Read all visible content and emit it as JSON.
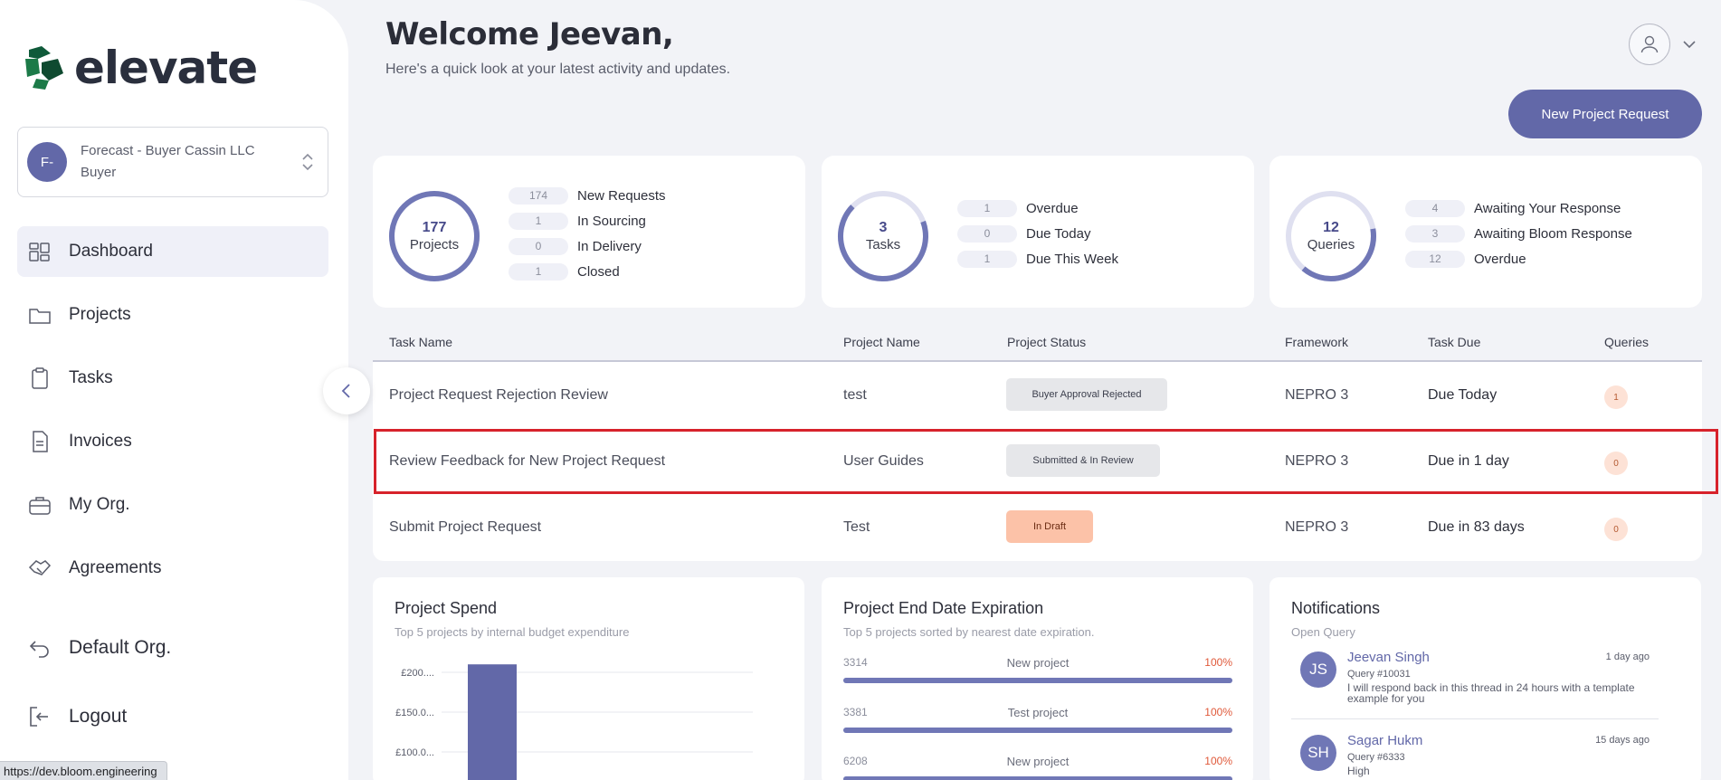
{
  "brand": {
    "name": "elevate"
  },
  "org": {
    "initials": "F-",
    "name": "Forecast - Buyer Cassin LLC",
    "role": "Buyer"
  },
  "nav": {
    "items": [
      {
        "label": "Dashboard",
        "icon": "dashboard-icon",
        "active": true
      },
      {
        "label": "Projects",
        "icon": "folder-icon"
      },
      {
        "label": "Tasks",
        "icon": "clipboard-icon"
      },
      {
        "label": "Invoices",
        "icon": "document-icon"
      },
      {
        "label": "My Org.",
        "icon": "briefcase-icon"
      },
      {
        "label": "Agreements",
        "icon": "handshake-icon"
      }
    ],
    "default_org": "Default Org.",
    "logout": "Logout"
  },
  "status_url": "https://dev.bloom.engineering",
  "header": {
    "welcome": "Welcome Jeevan,",
    "subtitle": "Here's a quick look at your latest activity and updates.",
    "new_project_label": "New Project Request"
  },
  "stats": {
    "projects": {
      "value": "177",
      "label": "Projects",
      "rows": [
        {
          "count": "174",
          "label": "New Requests"
        },
        {
          "count": "1",
          "label": "In Sourcing"
        },
        {
          "count": "0",
          "label": "In Delivery"
        },
        {
          "count": "1",
          "label": "Closed"
        }
      ]
    },
    "tasks": {
      "value": "3",
      "label": "Tasks",
      "rows": [
        {
          "count": "1",
          "label": "Overdue"
        },
        {
          "count": "0",
          "label": "Due Today"
        },
        {
          "count": "1",
          "label": "Due This Week"
        }
      ]
    },
    "queries": {
      "value": "12",
      "label": "Queries",
      "rows": [
        {
          "count": "4",
          "label": "Awaiting Your Response"
        },
        {
          "count": "3",
          "label": "Awaiting Bloom Response"
        },
        {
          "count": "12",
          "label": "Overdue"
        }
      ]
    }
  },
  "table": {
    "headers": {
      "task": "Task Name",
      "project": "Project Name",
      "status": "Project Status",
      "framework": "Framework",
      "due": "Task Due",
      "queries": "Queries"
    },
    "rows": [
      {
        "task": "Project Request Rejection Review",
        "project": "test",
        "status": "Buyer Approval Rejected",
        "framework": "NEPRO 3",
        "due": "Due Today",
        "queries": "1"
      },
      {
        "task": "Review Feedback for New Project Request",
        "project": "User Guides",
        "status": "Submitted & In Review",
        "framework": "NEPRO 3",
        "due": "Due in 1 day",
        "queries": "0"
      },
      {
        "task": "Submit Project Request",
        "project": "Test",
        "status": "In Draft",
        "framework": "NEPRO 3",
        "due": "Due in 83 days",
        "queries": "0"
      }
    ]
  },
  "spend": {
    "title": "Project Spend",
    "subtitle": "Top 5 projects by internal budget expenditure",
    "chart_data": {
      "type": "bar",
      "tick_labels": [
        "£200....",
        "£150.0...",
        "£100.0..."
      ],
      "ylim": [
        50,
        200
      ],
      "values": [
        210
      ],
      "bar_color": "#6268a8"
    }
  },
  "expiration": {
    "title": "Project End Date Expiration",
    "subtitle": "Top 5 projects sorted by nearest date expiration.",
    "rows": [
      {
        "id": "3314",
        "name": "New project",
        "pct": "100%",
        "fill": 1.0
      },
      {
        "id": "3381",
        "name": "Test project",
        "pct": "100%",
        "fill": 1.0
      },
      {
        "id": "6208",
        "name": "New project",
        "pct": "100%",
        "fill": 1.0
      }
    ]
  },
  "notifications": {
    "title": "Notifications",
    "subtitle": "Open Query",
    "items": [
      {
        "initials": "JS",
        "name": "Jeevan Singh",
        "time": "1 day ago",
        "query": "Query #10031",
        "body": "I will respond back in this thread in 24 hours with a template example for you"
      },
      {
        "initials": "SH",
        "name": "Sagar Hukm",
        "time": "15 days ago",
        "query": "Query #6333",
        "body": "High"
      }
    ]
  }
}
